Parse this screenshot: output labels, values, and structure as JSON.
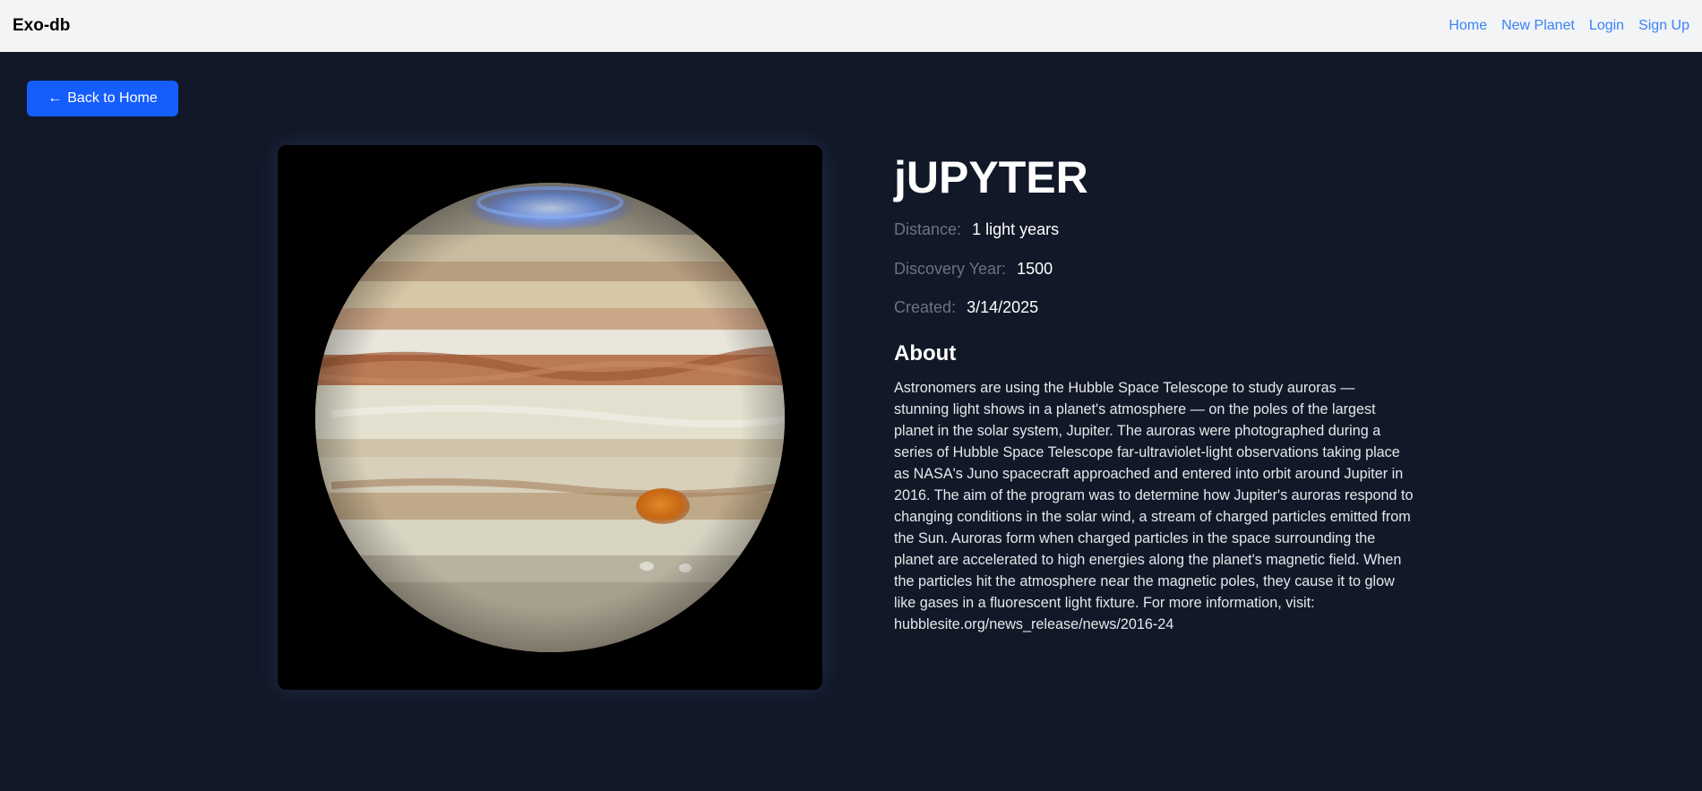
{
  "navbar": {
    "brand": "Exo-db",
    "links": [
      "Home",
      "New Planet",
      "Login",
      "Sign Up"
    ]
  },
  "back_button": {
    "arrow": "←",
    "label": "Back to Home"
  },
  "planet": {
    "name": "jUPYTER",
    "distance_label": "Distance:",
    "distance_value": "1 light years",
    "discovery_label": "Discovery Year:",
    "discovery_value": "1500",
    "created_label": "Created:",
    "created_value": "3/14/2025",
    "about_heading": "About",
    "about_text": "Astronomers are using the Hubble Space Telescope to study auroras — stunning light shows in a planet's atmosphere — on the poles of the largest planet in the solar system, Jupiter. The auroras were photographed during a series of Hubble Space Telescope far-ultraviolet-light observations taking place as NASA's Juno spacecraft approached and entered into orbit around Jupiter in 2016. The aim of the program was to determine how Jupiter's auroras respond to changing conditions in the solar wind, a stream of charged particles emitted from the Sun. Auroras form when charged particles in the space surrounding the planet are accelerated to high energies along the planet's magnetic field. When the particles hit the atmosphere near the magnetic poles, they cause it to glow like gases in a fluorescent light fixture. For more information, visit: hubblesite.org/news_release/news/2016-24"
  },
  "colors": {
    "background": "#111827",
    "navbar": "#f2f4f6",
    "accent": "#155dfc",
    "link": "#3b82f6",
    "muted": "#6b7280"
  }
}
